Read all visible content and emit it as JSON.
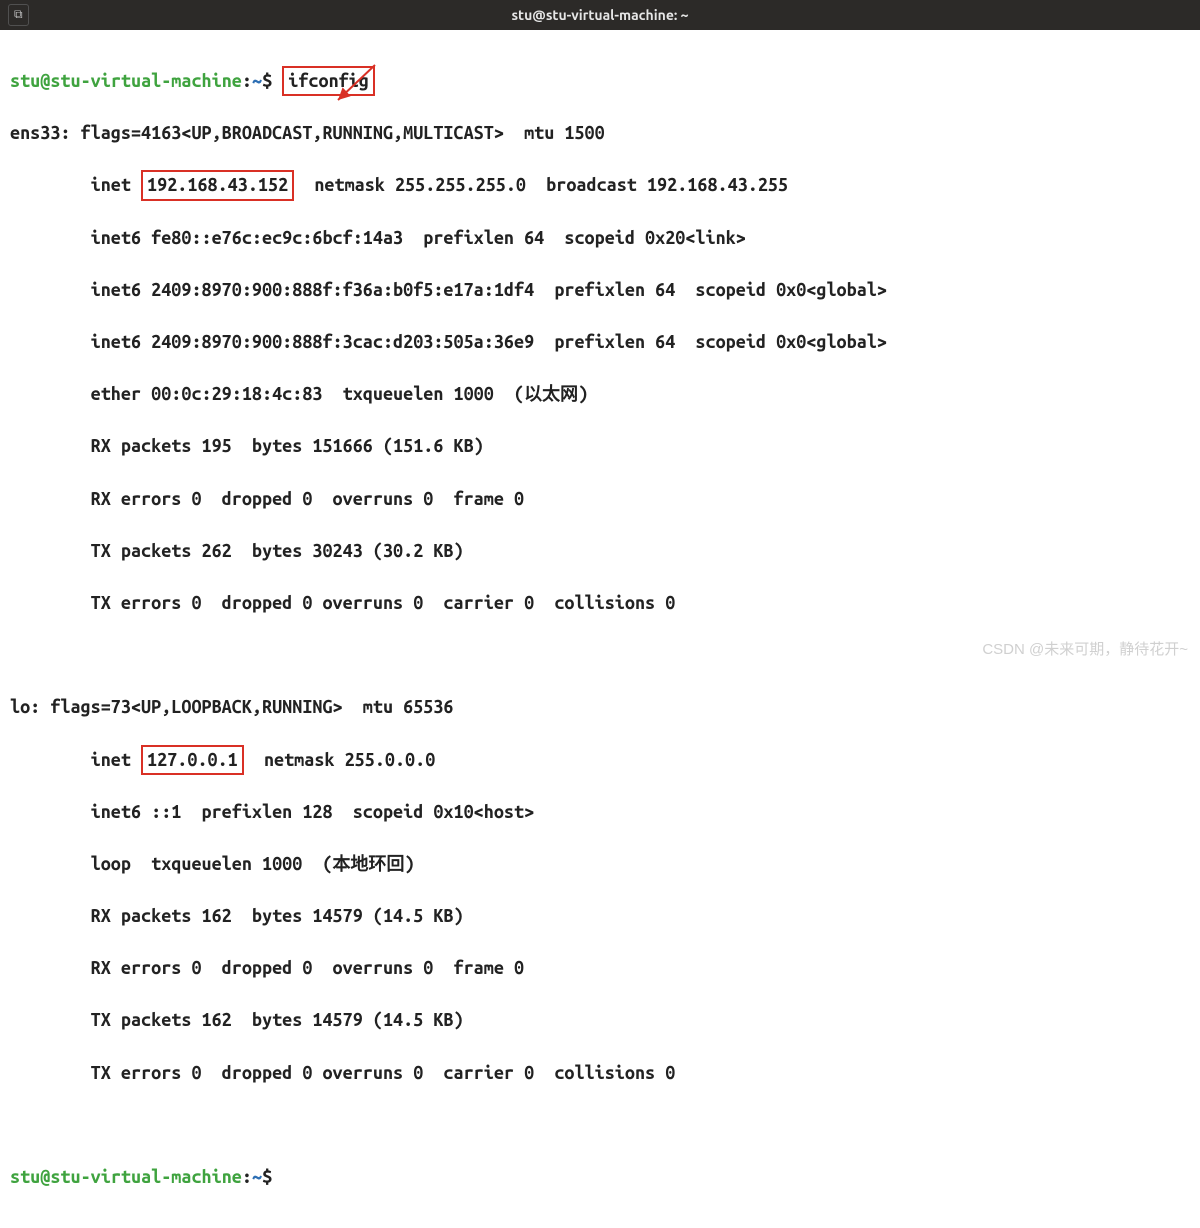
{
  "titlebar": {
    "title": "stu@stu-virtual-machine: ~",
    "tab_icon": "⧉"
  },
  "prompt": {
    "user": "stu",
    "at": "@",
    "host": "stu-virtual-machine",
    "colon": ":",
    "path": "~",
    "dollar": "$"
  },
  "command": "ifconfig",
  "ens33": {
    "header": "ens33: flags=4163<UP,BROADCAST,RUNNING,MULTICAST>  mtu 1500",
    "inet_pre": "        inet ",
    "inet_ip": "192.168.43.152",
    "inet_post": "  netmask 255.255.255.0  broadcast 192.168.43.255",
    "inet6_1": "        inet6 fe80::e76c:ec9c:6bcf:14a3  prefixlen 64  scopeid 0x20<link>",
    "inet6_2": "        inet6 2409:8970:900:888f:f36a:b0f5:e17a:1df4  prefixlen 64  scopeid 0x0<global>",
    "inet6_3": "        inet6 2409:8970:900:888f:3cac:d203:505a:36e9  prefixlen 64  scopeid 0x0<global>",
    "ether": "        ether 00:0c:29:18:4c:83  txqueuelen 1000  (以太网)",
    "rx_pkt": "        RX packets 195  bytes 151666 (151.6 KB)",
    "rx_err": "        RX errors 0  dropped 0  overruns 0  frame 0",
    "tx_pkt": "        TX packets 262  bytes 30243 (30.2 KB)",
    "tx_err": "        TX errors 0  dropped 0 overruns 0  carrier 0  collisions 0"
  },
  "lo": {
    "header": "lo: flags=73<UP,LOOPBACK,RUNNING>  mtu 65536",
    "inet_pre": "        inet ",
    "inet_ip": "127.0.0.1",
    "inet_post": "  netmask 255.0.0.0",
    "inet6": "        inet6 ::1  prefixlen 128  scopeid 0x10<host>",
    "loop": "        loop  txqueuelen 1000  (本地环回)",
    "rx_pkt": "        RX packets 162  bytes 14579 (14.5 KB)",
    "rx_err": "        RX errors 0  dropped 0  overruns 0  frame 0",
    "tx_pkt": "        TX packets 162  bytes 14579 (14.5 KB)",
    "tx_err": "        TX errors 0  dropped 0 overruns 0  carrier 0  collisions 0"
  },
  "watermark": "CSDN @未来可期，静待花开~"
}
